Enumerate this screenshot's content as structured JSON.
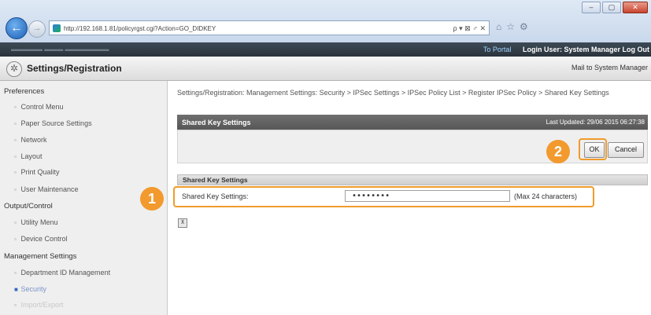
{
  "browser": {
    "url": "http://192.168.1.81/policyrgst.cgi?Action=GO_DIDKEY",
    "addr_controls": "ρ ▾ ⊠ ♂ ✕",
    "window_buttons": [
      "–",
      "▢",
      "✕"
    ],
    "back_icon": "←",
    "forward_icon": "→",
    "toolbar_icons": [
      "home-icon",
      "star-icon",
      "gear-icon"
    ]
  },
  "topbar": {
    "portal_link": "To Portal",
    "login_user": "Login User: System Manager Log Out"
  },
  "header": {
    "title": "Settings/Registration",
    "mail_link": "Mail to System Manager"
  },
  "sidebar": {
    "groups": [
      {
        "heading": "Preferences",
        "items": [
          "Control Menu",
          "Paper Source Settings",
          "Network",
          "Layout",
          "Print Quality",
          "User Maintenance"
        ]
      },
      {
        "heading": "Output/Control",
        "items": [
          "Utility Menu",
          "Device Control"
        ]
      },
      {
        "heading": "Management Settings",
        "items": [
          "Department ID Management",
          "Security",
          "Import/Export"
        ]
      }
    ]
  },
  "main": {
    "breadcrumb": "Settings/Registration: Management Settings: Security > IPSec Settings > IPSec Policy List > Register IPSec Policy > Shared Key Settings",
    "panel_title": "Shared Key Settings",
    "last_updated": "Last Updated: 29/06 2015 06:27:38",
    "ok_label": "OK",
    "cancel_label": "Cancel",
    "section_title": "Shared Key Settings",
    "field_label": "Shared Key Settings:",
    "field_value": "••••••••",
    "field_hint": "(Max 24 characters)",
    "callout_1": "1",
    "callout_2": "2",
    "top_icon": "⊼"
  },
  "colors": {
    "highlight": "#f19b2b",
    "panel_head": "#5e5e5e",
    "topbar": "#2f3942"
  }
}
